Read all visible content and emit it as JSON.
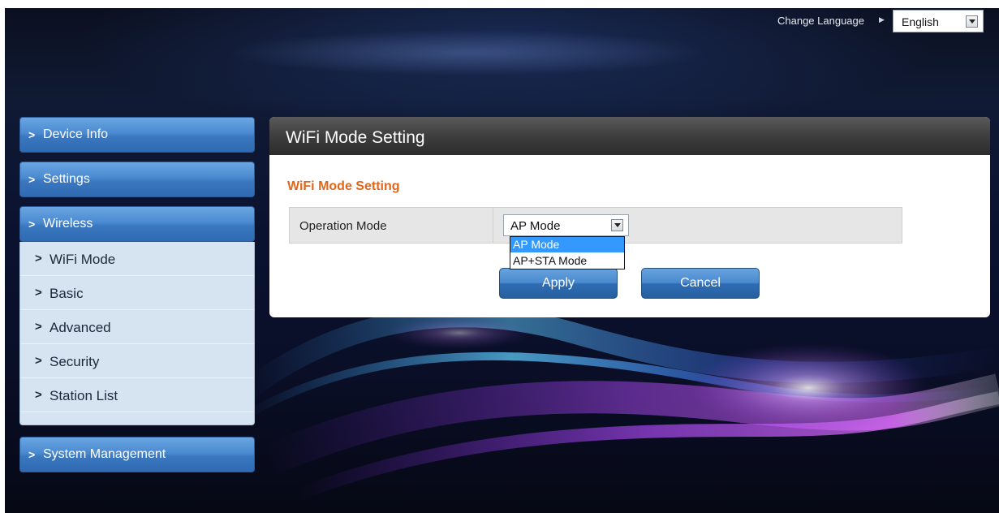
{
  "header": {
    "change_language_label": "Change Language",
    "language": "English"
  },
  "sidebar": {
    "items": [
      {
        "label": "Device Info"
      },
      {
        "label": "Settings"
      },
      {
        "label": "Wireless"
      },
      {
        "label": "System Management"
      }
    ],
    "wireless_submenu": [
      {
        "label": "WiFi Mode"
      },
      {
        "label": "Basic"
      },
      {
        "label": "Advanced"
      },
      {
        "label": "Security"
      },
      {
        "label": "Station List"
      }
    ],
    "chevron": ">"
  },
  "main": {
    "panel_title": "WiFi Mode Setting",
    "section_title": "WiFi Mode Setting",
    "operation_mode_label": "Operation Mode",
    "operation_mode_value": "AP Mode",
    "operation_mode_options": [
      "AP Mode",
      "AP+STA Mode"
    ],
    "apply_label": "Apply",
    "cancel_label": "Cancel"
  },
  "colors": {
    "accent_orange": "#e0661c",
    "button_blue": "#4a89cf",
    "selected_option": "#3399ff"
  }
}
